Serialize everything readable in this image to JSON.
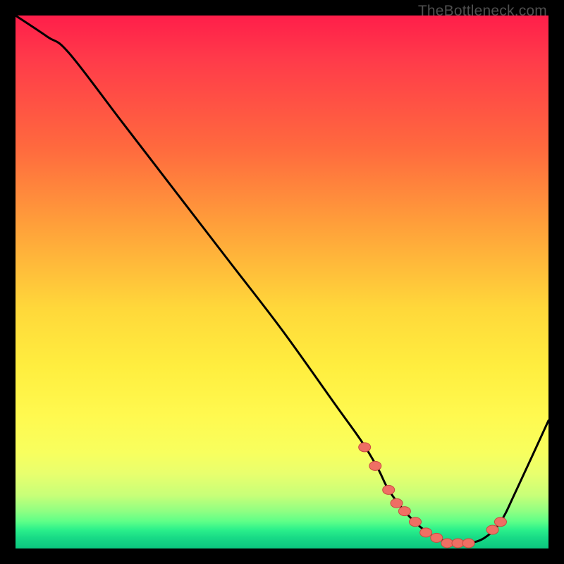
{
  "watermark": "TheBottleneck.com",
  "colors": {
    "frame": "#000000",
    "curve": "#000000",
    "marker_fill": "#ef6f64",
    "marker_stroke": "#c94b41",
    "gradient_top": "#ff1e4a",
    "gradient_mid": "#ffee3f",
    "gradient_bottom": "#0bc77f"
  },
  "chart_data": {
    "type": "line",
    "title": "",
    "xlabel": "",
    "ylabel": "",
    "xlim": [
      0,
      100
    ],
    "ylim": [
      0,
      100
    ],
    "series": [
      {
        "name": "bottleneck-curve",
        "x": [
          0,
          6,
          10,
          20,
          30,
          40,
          50,
          60,
          65,
          68,
          70,
          73,
          76,
          79,
          82,
          85,
          88,
          91,
          94,
          100
        ],
        "values": [
          100,
          96,
          93,
          80,
          67,
          54,
          41,
          27,
          20,
          15,
          11,
          7,
          4,
          2,
          1,
          1,
          2,
          5,
          11,
          24
        ]
      }
    ],
    "markers": {
      "name": "highlight-points",
      "x": [
        65.5,
        67.5,
        70,
        71.5,
        73,
        75,
        77,
        79,
        81,
        83,
        85,
        89.5,
        91
      ],
      "values": [
        19,
        15.5,
        11,
        8.5,
        7,
        5,
        3,
        2,
        1,
        1,
        1,
        3.5,
        5
      ]
    }
  }
}
